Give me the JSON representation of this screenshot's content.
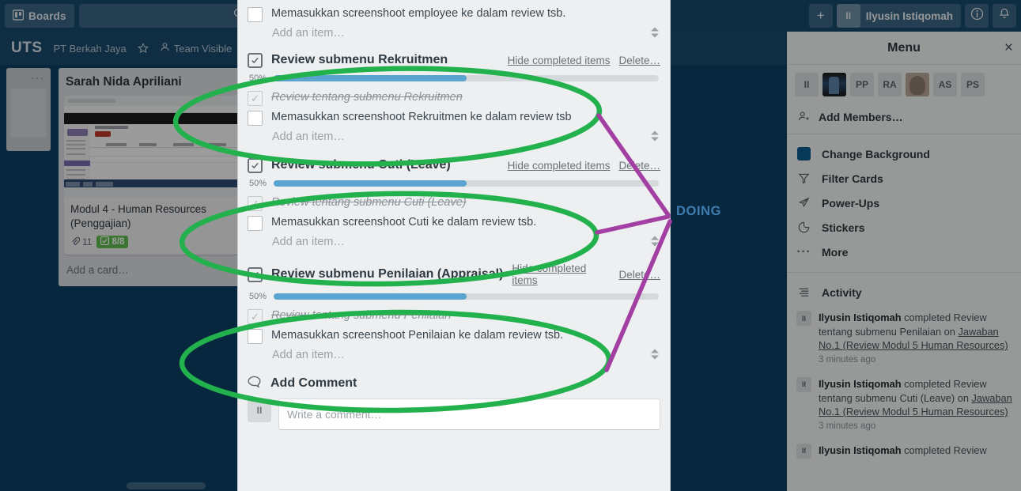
{
  "colors": {
    "board_blue": "#0b4064",
    "topbar_blue": "#15496d",
    "progress_blue": "#5ba4cf",
    "annotation_green": "#22b14c",
    "annotation_purple": "#a33ea3",
    "doing_label": "#3f7cb0",
    "badge_green": "#61bd4f"
  },
  "topbar": {
    "boards_label": "Boards",
    "boards_icon": "board-icon",
    "search_placeholder": "",
    "search_icon": "search-icon",
    "plus_icon": "plus-icon",
    "user_name": "Ilyusin Istiqomah",
    "user_initials": "II",
    "info_icon": "info-icon",
    "bell_icon": "notification-bell-icon"
  },
  "boardbar": {
    "title": "UTS",
    "team_name": "PT Berkah Jaya",
    "star_icon": "star-icon",
    "visibility": "Team Visible",
    "visibility_icon": "team-visible-icon"
  },
  "board": {
    "ghost_list_menu_icon": "list-menu-icon",
    "list": {
      "title": "Sarah Nida Apriliani",
      "add_card_label": "Add a card…",
      "card": {
        "title": "Modul 4 - Human Resources (Penggajian)",
        "attachment_icon": "attachment-icon",
        "attachment_count": "11",
        "checklist_icon": "checklist-icon",
        "checklist_count": "8/8"
      }
    }
  },
  "modal": {
    "top_item": {
      "text": "Memasukkan screenshoot employee ke dalam review tsb.",
      "checked": false
    },
    "top_add_item": "Add an item…",
    "checklists": [
      {
        "title": "Review submenu Rekruitmen",
        "hide_label": "Hide completed items",
        "delete_label": "Delete…",
        "percent_label": "50%",
        "percent": 50,
        "items": [
          {
            "text": "Review tentang submenu Rekruitmen",
            "checked": true
          },
          {
            "text": "Memasukkan screenshoot Rekruitmen ke dalam review tsb",
            "checked": false
          }
        ],
        "add_item": "Add an item…"
      },
      {
        "title": "Review submenu Cuti (Leave)",
        "hide_label": "Hide completed items",
        "delete_label": "Delete…",
        "percent_label": "50%",
        "percent": 50,
        "items": [
          {
            "text": "Review tentang submenu Cuti (Leave)",
            "checked": true
          },
          {
            "text": "Memasukkan screenshoot Cuti ke dalam review tsb.",
            "checked": false
          }
        ],
        "add_item": "Add an item…"
      },
      {
        "title": "Review submenu Penilaian (Appraisal)",
        "hide_label": "Hide completed items",
        "delete_label": "Delete…",
        "percent_label": "50%",
        "percent": 50,
        "items": [
          {
            "text": "Review tentang submenu Penilaian",
            "checked": true
          },
          {
            "text": "Memasukkan screenshoot Penilaian ke dalam review tsb.",
            "checked": false
          }
        ],
        "add_item": "Add an item…"
      }
    ],
    "comment": {
      "heading": "Add Comment",
      "icon": "comment-bubble-icon",
      "avatar_initials": "II",
      "placeholder": "Write a comment…"
    }
  },
  "right_menu": {
    "title": "Menu",
    "close_icon": "close-icon",
    "members": [
      {
        "label": "II",
        "type": "initials"
      },
      {
        "label": "",
        "type": "photo1"
      },
      {
        "label": "PP",
        "type": "initials"
      },
      {
        "label": "RA",
        "type": "initials"
      },
      {
        "label": "",
        "type": "photo2"
      },
      {
        "label": "AS",
        "type": "initials"
      },
      {
        "label": "PS",
        "type": "initials"
      }
    ],
    "add_members_label": "Add Members…",
    "add_members_icon": "add-member-icon",
    "items": [
      {
        "label": "Change Background",
        "icon": "color-swatch-icon"
      },
      {
        "label": "Filter Cards",
        "icon": "funnel-icon"
      },
      {
        "label": "Power-Ups",
        "icon": "rocket-icon"
      },
      {
        "label": "Stickers",
        "icon": "sticker-icon"
      },
      {
        "label": "More",
        "icon": "ellipsis-icon"
      }
    ],
    "activity_label": "Activity",
    "activity_icon": "activity-list-icon",
    "activities": [
      {
        "avatar": "II",
        "user": "Ilyusin Istiqomah",
        "action": " completed Review tentang submenu Penilaian on ",
        "link": "Jawaban No.1 (Review Modul 5 Human Resources)",
        "time": "3 minutes ago"
      },
      {
        "avatar": "II",
        "user": "Ilyusin Istiqomah",
        "action": " completed Review tentang submenu Cuti (Leave) on ",
        "link": "Jawaban No.1 (Review Modul 5 Human Resources)",
        "time": "3 minutes ago"
      },
      {
        "avatar": "II",
        "user": "Ilyusin Istiqomah",
        "action": " completed Review",
        "link": "",
        "time": ""
      }
    ]
  },
  "annotations": {
    "doing_label": "DOING"
  }
}
